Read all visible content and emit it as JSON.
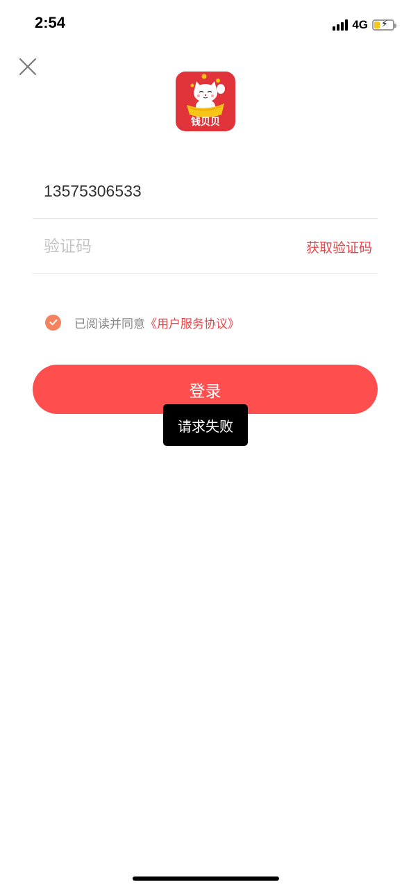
{
  "status_bar": {
    "time": "2:54",
    "network": "4G",
    "battery_level": 0.3,
    "battery_color": "#f5c518",
    "signal_bars": 4
  },
  "header": {
    "close_icon": "close-icon"
  },
  "logo": {
    "text": "钱贝贝",
    "background": "#e0343a"
  },
  "form": {
    "phone_value": "13575306533",
    "code_placeholder": "验证码",
    "get_code_label": "获取验证码"
  },
  "agreement": {
    "checked": true,
    "text": "已阅读并同意",
    "link": "《用户服务协议》"
  },
  "login": {
    "label": "登录",
    "color": "#fe4e4e"
  },
  "toast": {
    "message": "请求失败"
  },
  "colors": {
    "accent": "#e2484b",
    "check": "#f4825f"
  }
}
